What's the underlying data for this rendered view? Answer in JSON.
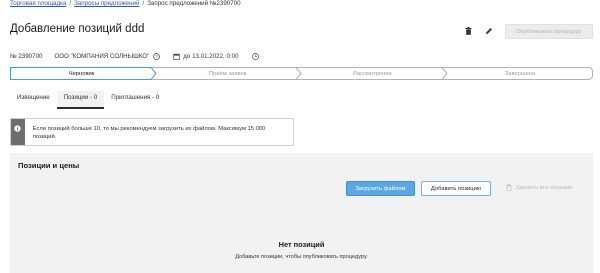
{
  "breadcrumb": {
    "items": [
      "Торговая площадка",
      "Запросы предложений",
      "Запрос предложений №2390700"
    ],
    "separator": "/"
  },
  "header": {
    "title": "Добавление позиций ddd",
    "publish_label": "Опубликовать процедуру",
    "icons": [
      "trash-icon",
      "pencil-icon"
    ]
  },
  "meta": {
    "number": "№ 2390700",
    "company": "ООО \"КОМПАНИЯ СОЛНЫШКО\"",
    "deadline": "до 13.01.2022, 0:00"
  },
  "stepper": {
    "steps": [
      {
        "label": "Черновик",
        "active": true
      },
      {
        "label": "Приём заявок",
        "active": false
      },
      {
        "label": "Рассмотрение",
        "active": false
      },
      {
        "label": "Завершена",
        "active": false
      }
    ]
  },
  "tabs": [
    {
      "label": "Извещение",
      "active": false
    },
    {
      "label": "Позиции - 0",
      "active": true
    },
    {
      "label": "Приглашения - 0",
      "active": false
    }
  ],
  "info": {
    "text": "Если позиций больше 10, то мы рекомендуем загрузить их файлом. Максимум 15 000 позиций."
  },
  "positions": {
    "title": "Позиции и цены",
    "upload_label": "Загрузить файлом",
    "add_label": "Добавить позицию",
    "delete_all_label": "Удалить все позиции",
    "empty_title": "Нет позиций",
    "empty_subtitle": "Добавьте позиции, чтобы опубликовать процедуру."
  },
  "colors": {
    "accent": "#5aa7e5",
    "link": "#2a5bbf",
    "info_strip": "#6e6e6e",
    "section_bg": "#f2f2f2"
  }
}
